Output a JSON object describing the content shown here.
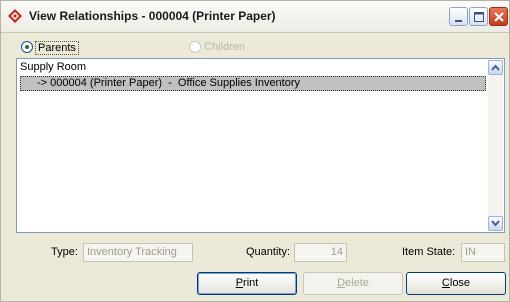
{
  "window": {
    "title": "View Relationships - 000004 (Printer Paper)"
  },
  "relationship_mode": {
    "parents_label": "Parents",
    "children_label": "Children",
    "selected": "Parents"
  },
  "list": {
    "header": "Supply Room",
    "rows": [
      {
        "text": "-> 000004 (Printer Paper)  -  Office Supplies Inventory",
        "selected": true
      }
    ]
  },
  "details": {
    "type_label": "Type:",
    "type_value": "Inventory Tracking",
    "quantity_label": "Quantity:",
    "quantity_value": "14",
    "item_state_label": "Item State:",
    "item_state_value": "IN"
  },
  "buttons": {
    "print_accel": "P",
    "print_rest": "rint",
    "delete_accel": "D",
    "delete_rest": "elete",
    "close_accel": "C",
    "close_rest": "lose"
  },
  "icons": {
    "app": "app-diamond-icon",
    "minimize": "minimize-icon",
    "maximize": "maximize-icon",
    "close": "close-icon",
    "scroll_up": "scroll-up-arrow-icon",
    "scroll_down": "scroll-down-arrow-icon"
  },
  "colors": {
    "window_bg": "#ece9d8",
    "selection_bg": "#c0c0c0",
    "button_border": "#003c74",
    "close_button": "#c23b1e"
  }
}
